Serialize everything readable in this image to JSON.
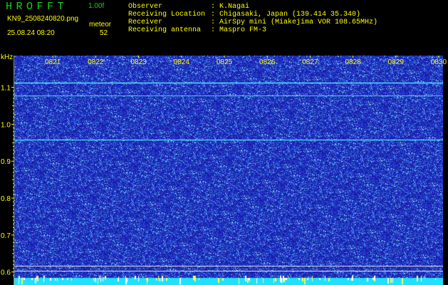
{
  "header": {
    "app_name": "HROFFT",
    "version": "1.00f",
    "file_name": "KN9_2508240820.png",
    "meteor_label": "meteor",
    "datetime": "25.08.24 08:20",
    "meteor_count": "52",
    "info_rows": [
      {
        "key": "Observer",
        "value": ": K.Nagai"
      },
      {
        "key": "Receiving Location",
        "value": ": Chigasaki, Japan (139.414 35.340)"
      },
      {
        "key": "Receiver",
        "value": ": AirSpy mini (Miakejima VOR 108.65MHz)"
      },
      {
        "key": "Receiving antenna",
        "value": ": Maspro FM-3"
      }
    ]
  },
  "chart_data": {
    "type": "heatmap",
    "title": "",
    "ylabel": "kHz",
    "xlabel": "",
    "y_ticks": [
      1.1,
      1.0,
      0.9,
      0.8,
      0.7,
      0.6
    ],
    "y_tick_labels": [
      "1.1",
      "1.0",
      "0.9",
      "0.8",
      "0.7",
      "0.6"
    ],
    "ylim": [
      0.584,
      1.186
    ],
    "x_ticks": [
      "0821",
      "0822",
      "0823",
      "0824",
      "0825",
      "0826",
      "0827",
      "0828",
      "0829",
      "0830"
    ],
    "xlim_minutes": [
      0,
      10
    ],
    "tick_minutes": [
      0.9,
      1.9,
      2.9,
      3.9,
      4.9,
      5.9,
      6.9,
      7.9,
      8.9,
      9.9
    ],
    "persistent_lines_khz": [
      1.113,
      1.078,
      0.958
    ],
    "reference_lines_khz": [
      0.617,
      0.604
    ],
    "colors": {
      "background": "#1a1aa6",
      "noise_bright": "#5fd8ff",
      "carrier": "#55e6ff",
      "baseline": "#20e0ff",
      "burst": "#ffff40",
      "label": "#ffff00",
      "header_green": "#19d219"
    }
  }
}
